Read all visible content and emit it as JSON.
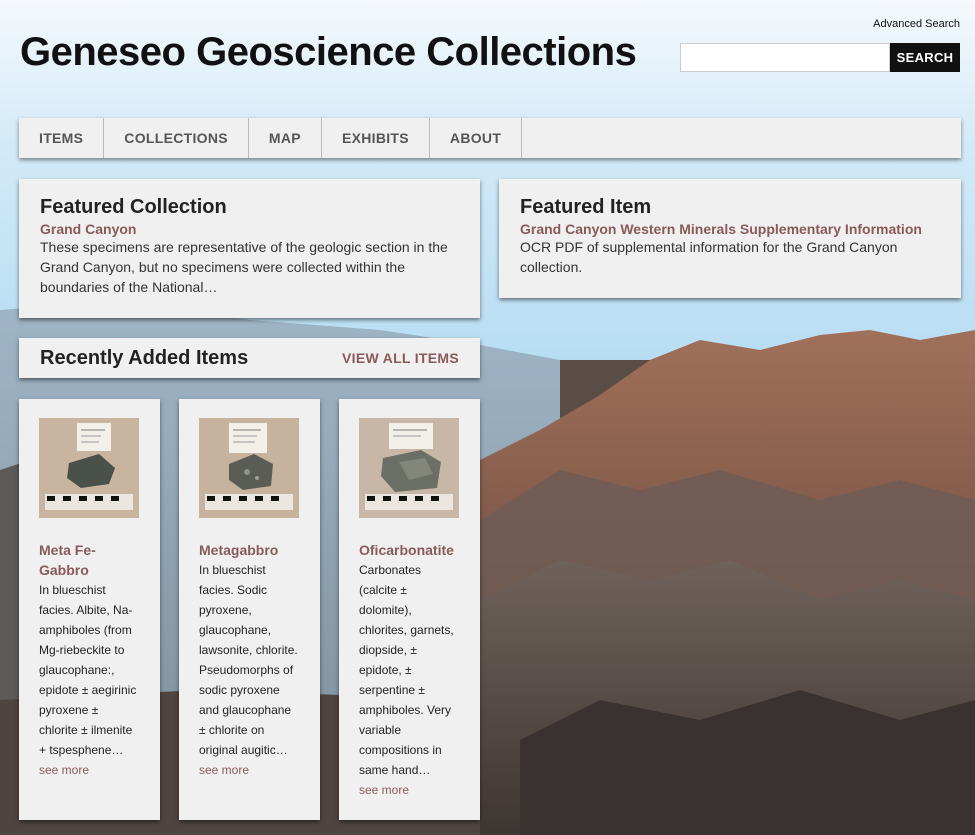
{
  "header": {
    "site_title": "Geneseo Geoscience Collections",
    "advanced_search": "Advanced Search",
    "search_button": "SEARCH",
    "search_value": ""
  },
  "nav": {
    "items": [
      {
        "label": "ITEMS"
      },
      {
        "label": "COLLECTIONS"
      },
      {
        "label": "MAP"
      },
      {
        "label": "EXHIBITS"
      },
      {
        "label": "ABOUT"
      }
    ]
  },
  "featured_collection": {
    "heading": "Featured Collection",
    "title": "Grand Canyon",
    "description": "These specimens are representative of the geologic section in the Grand Canyon, but no specimens were collected within the boundaries of the National…"
  },
  "featured_item": {
    "heading": "Featured Item",
    "title": "Grand Canyon Western Minerals Supplementary Information",
    "description": "OCR PDF of supplemental information for the Grand Canyon collection."
  },
  "recent": {
    "heading": "Recently Added Items",
    "view_all": "VIEW ALL ITEMS",
    "items": [
      {
        "title": "Meta Fe-Gabbro",
        "description": "In blueschist facies. Albite, Na-amphiboles (from Mg-riebeckite to glaucophane:, epidote ± aegirinic pyroxene ± chlorite ± ilmenite + tspesphene…",
        "see_more": "see more"
      },
      {
        "title": "Metagabbro",
        "description": "In blueschist facies. Sodic pyroxene, glaucophane, lawsonite, chlorite. Pseudomorphs of sodic pyroxene and glaucophane ± chlorite on original augitic…",
        "see_more": "see more"
      },
      {
        "title": "Oficarbonatite",
        "description": "Carbonates (calcite ± dolomite), chlorites, garnets, diopside, ± epidote, ± serpentine ± amphiboles. Very variable compositions in same hand…",
        "see_more": "see more"
      }
    ]
  },
  "colors": {
    "link": "#8a5a5a",
    "panel_bg": "#f0f0f0",
    "search_button_bg": "#111111"
  }
}
